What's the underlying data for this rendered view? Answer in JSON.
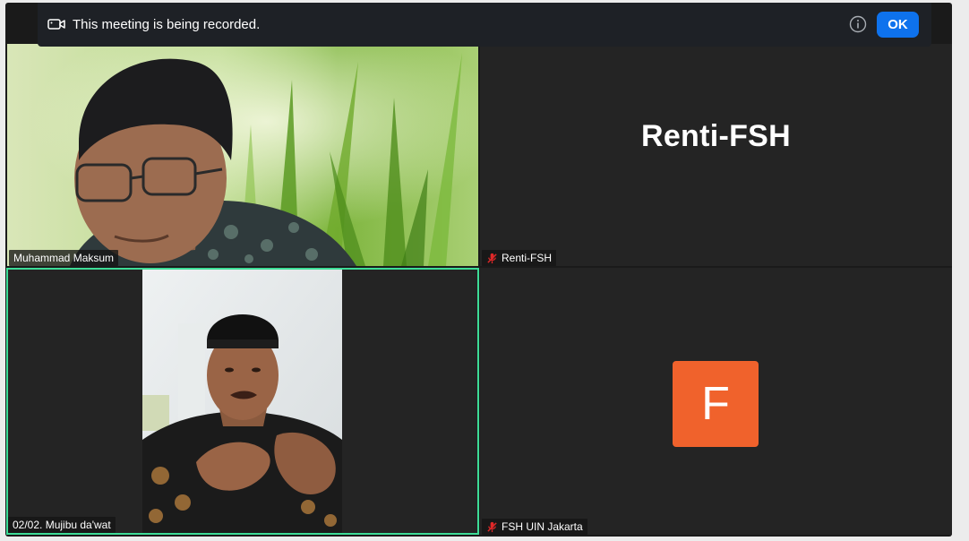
{
  "banner": {
    "icon": "video-camera-icon",
    "message": "This meeting is being recorded.",
    "info_icon": "info-icon",
    "ok_label": "OK"
  },
  "participants": [
    {
      "name": "Muhammad Maksum",
      "muted": false,
      "video": true
    },
    {
      "name": "Renti-FSH",
      "display_name": "Renti-FSH",
      "muted": true,
      "video": false
    },
    {
      "name": "02/02. Mujibu da'wat",
      "muted": false,
      "video": true,
      "active_speaker": true
    },
    {
      "name": "FSH UIN Jakarta",
      "avatar_letter": "F",
      "muted": true,
      "video": false
    }
  ],
  "colors": {
    "avatar": "#f0622c",
    "active_speaker_border": "#3ddc97",
    "ok_button": "#0e72ed",
    "mute": "#e02828"
  }
}
